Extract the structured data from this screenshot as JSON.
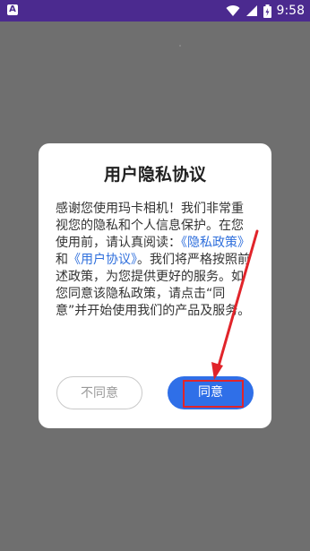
{
  "status_bar": {
    "app_icon_label": "A",
    "time": "9:58"
  },
  "dialog": {
    "title": "用户隐私协议",
    "body_lead": "感谢您使用玛卡相机！我们非常重视您的隐私和个人信息保护。在您使用前，请认真阅读：",
    "link_privacy": "《隐私政策》",
    "and": "和",
    "link_user": "《用户协议》",
    "body_tail": "。我们将严格按照前述政策，为您提供更好的服务。如您同意该隐私政策，请点击“同意”并开始使用我们的产品及服务。",
    "disagree_label": "不同意",
    "agree_label": "同意"
  },
  "colors": {
    "status_bar": "#4b2a8f",
    "overlay": "#6f6f6f",
    "link": "#2f6fdc",
    "primary": "#2f6fe8",
    "annotation": "#e1242a"
  }
}
